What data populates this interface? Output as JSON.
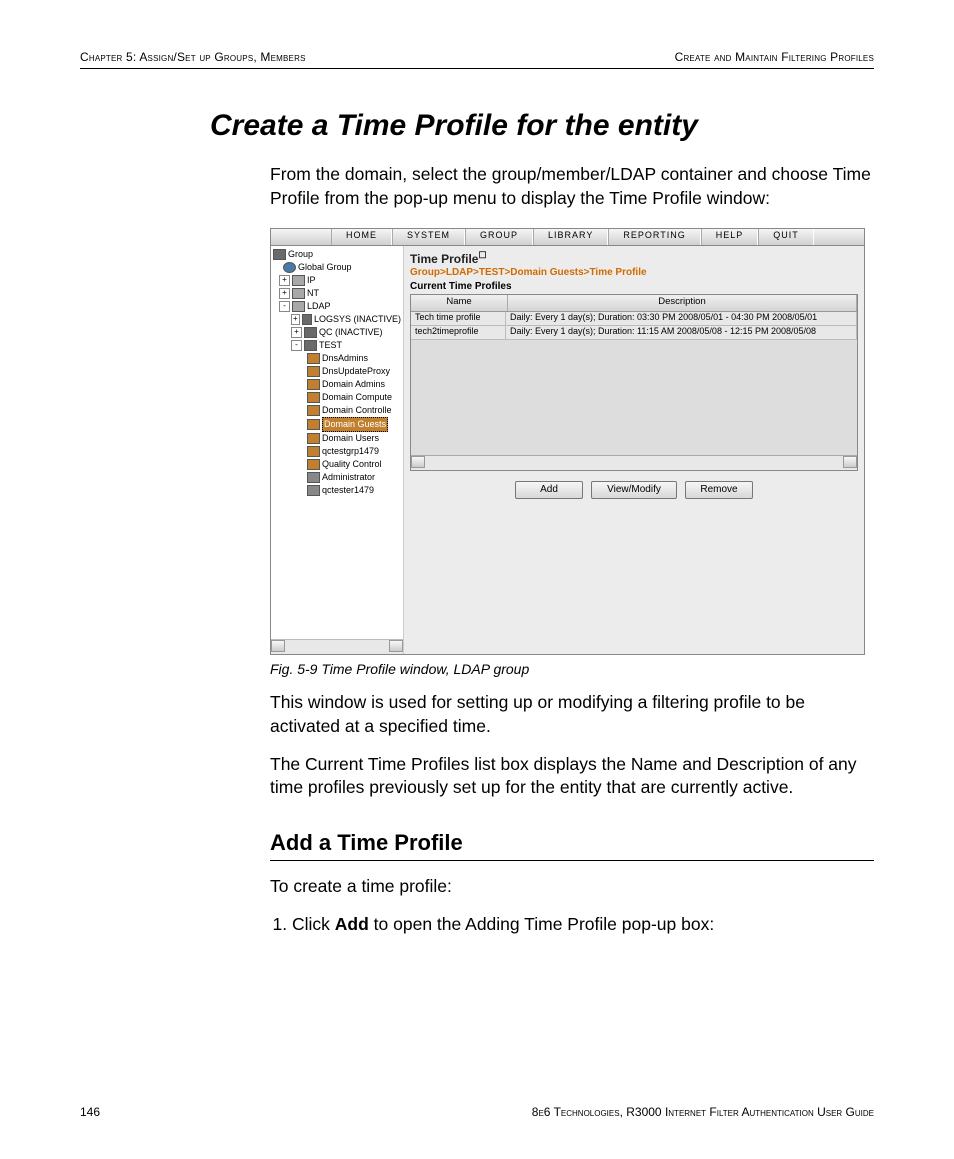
{
  "header": {
    "left": "Chapter 5: Assign/Set up Groups, Members",
    "right": "Create and Maintain Filtering Profiles"
  },
  "title": "Create a Time Profile for the entity",
  "intro": "From the domain, select the group/member/LDAP container and choose Time Profile from the pop-up menu to display the Time Profile window:",
  "caption": "Fig. 5-9  Time Profile window, LDAP group",
  "para1": "This window is used for setting up or modifying a filtering profile to be activated at a specified time.",
  "para2": "The Current Time Profiles list box displays the Name and Description of any time profiles previously set up for the entity that are currently active.",
  "subheading": "Add a Time Profile",
  "lead": "To create a time profile:",
  "step1_pre": "Click ",
  "step1_bold": "Add",
  "step1_post": " to open the Adding Time Profile pop-up box:",
  "footer": {
    "page": "146",
    "doc": "8e6 Technologies, R3000 Internet Filter Authentication User Guide"
  },
  "shot": {
    "menu": [
      "HOME",
      "SYSTEM",
      "GROUP",
      "LIBRARY",
      "REPORTING",
      "HELP",
      "QUIT"
    ],
    "tree": {
      "root": "Group",
      "globe": "Global Group",
      "ip": "IP",
      "nt": "NT",
      "ldap": "LDAP",
      "logsys": "LOGSYS (INACTIVE)",
      "qc": "QC (INACTIVE)",
      "test": "TEST",
      "test_children": [
        "DnsAdmins",
        "DnsUpdateProxy",
        "Domain Admins",
        "Domain Compute",
        "Domain Controlle",
        "Domain Guests",
        "Domain Users",
        "qctestgrp1479",
        "Quality Control",
        "Administrator",
        "qctester1479"
      ]
    },
    "cp": {
      "title": "Time Profile",
      "breadcrumb": "Group>LDAP>TEST>Domain Guests>Time Profile",
      "panel": "Current Time Profiles",
      "cols": {
        "name": "Name",
        "desc": "Description"
      },
      "rows": [
        {
          "name": "Tech time profile",
          "desc": "Daily: Every 1 day(s); Duration: 03:30 PM 2008/05/01 - 04:30 PM 2008/05/01"
        },
        {
          "name": "tech2timeprofile",
          "desc": "Daily: Every 1 day(s); Duration: 11:15 AM 2008/05/08 - 12:15 PM 2008/05/08"
        }
      ],
      "buttons": {
        "add": "Add",
        "view": "View/Modify",
        "remove": "Remove"
      }
    }
  }
}
